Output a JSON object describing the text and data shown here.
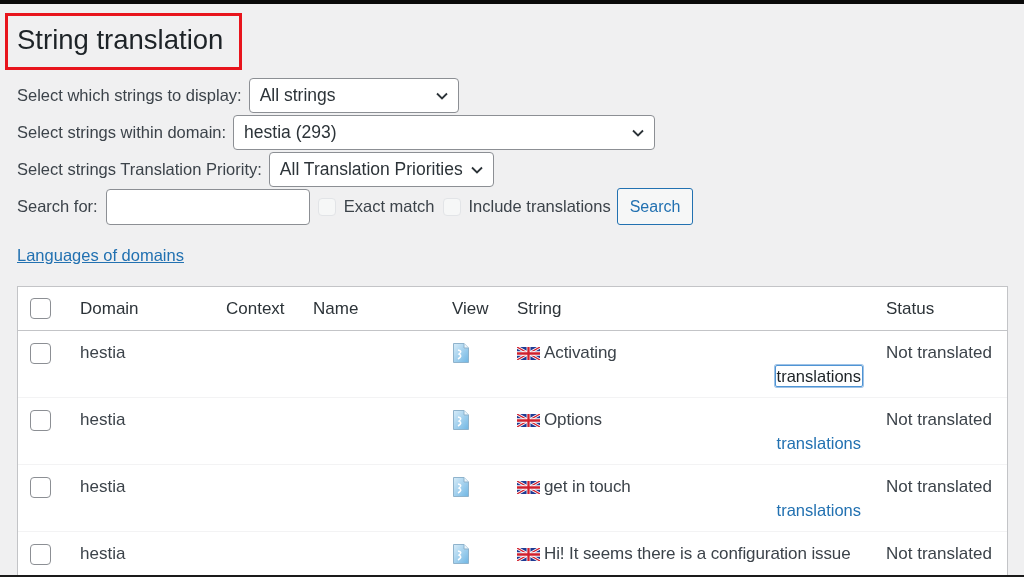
{
  "page_title": "String translation",
  "filters": [
    {
      "label": "Select which strings to display:",
      "value": "All strings"
    },
    {
      "label": "Select strings within domain:",
      "value": "hestia (293)"
    },
    {
      "label": "Select strings Translation Priority:",
      "value": "All Translation Priorities"
    }
  ],
  "search": {
    "label": "Search for:",
    "button": "Search"
  },
  "options": [
    {
      "label": "Exact match",
      "checked": false
    },
    {
      "label": "Include translations",
      "checked": false
    }
  ],
  "domains_link": "Languages of domains",
  "table": {
    "select_all_checked": false,
    "columns": [
      "Domain",
      "Context",
      "Name",
      "View",
      "String",
      "Status"
    ],
    "rows": [
      {
        "checked": false,
        "domain": "hestia",
        "string": "Activating",
        "link": {
          "label": "translations",
          "focused": true
        },
        "status": "Not translated"
      },
      {
        "checked": false,
        "domain": "hestia",
        "string": "Options",
        "link": {
          "label": "translations",
          "focused": false
        },
        "status": "Not translated"
      },
      {
        "checked": false,
        "domain": "hestia",
        "string": "get in touch",
        "link": {
          "label": "translations",
          "focused": false
        },
        "status": "Not translated"
      },
      {
        "checked": false,
        "domain": "hestia",
        "string": "Hi! It seems there is a configuration issue",
        "status": "Not translated"
      }
    ]
  }
}
